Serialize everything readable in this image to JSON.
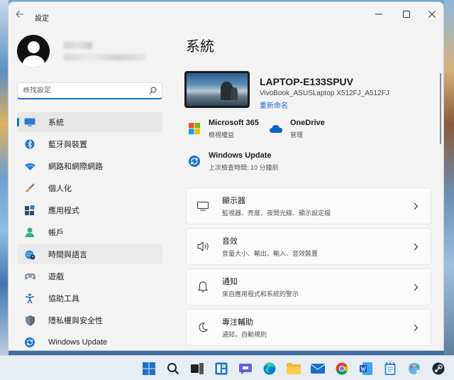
{
  "window": {
    "title": "設定"
  },
  "profile": {
    "avatar_icon": "user-avatar"
  },
  "search": {
    "placeholder": "尋找設定"
  },
  "sidebar": {
    "items": [
      {
        "label": "系統",
        "icon": "monitor-icon",
        "active": true
      },
      {
        "label": "藍牙與裝置",
        "icon": "bluetooth-icon"
      },
      {
        "label": "網路和網際網路",
        "icon": "wifi-icon"
      },
      {
        "label": "個人化",
        "icon": "brush-icon"
      },
      {
        "label": "應用程式",
        "icon": "apps-icon"
      },
      {
        "label": "帳戶",
        "icon": "person-icon"
      },
      {
        "label": "時間與語言",
        "icon": "globe-clock-icon",
        "hover": true
      },
      {
        "label": "遊戲",
        "icon": "gamepad-icon"
      },
      {
        "label": "協助工具",
        "icon": "accessibility-icon"
      },
      {
        "label": "隱私權與安全性",
        "icon": "shield-icon"
      },
      {
        "label": "Windows Update",
        "icon": "update-icon"
      }
    ]
  },
  "main": {
    "title": "系統",
    "device": {
      "name": "LAPTOP-E133SPUV",
      "model": "VivoBook_ASUSLaptop X512FJ_A512FJ",
      "rename": "重新命名"
    },
    "quick": [
      {
        "title": "Microsoft 365",
        "sub": "檢視權益",
        "icon": "microsoft-logo-icon"
      },
      {
        "title": "OneDrive",
        "sub": "管理",
        "icon": "cloud-icon"
      },
      {
        "title": "Windows Update",
        "sub": "上次檢查時間: 10 分鐘前",
        "icon": "update-icon"
      }
    ],
    "cards": [
      {
        "title": "顯示器",
        "desc": "監視器、亮度、夜間光線、顯示設定檔",
        "icon": "display-icon"
      },
      {
        "title": "音效",
        "desc": "音量大小、輸出、輸入、音效裝置",
        "icon": "speaker-icon"
      },
      {
        "title": "通知",
        "desc": "來自應用程式和系統的警示",
        "icon": "bell-icon"
      },
      {
        "title": "專注輔助",
        "desc": "通知，自動規則",
        "icon": "moon-icon"
      }
    ]
  },
  "colors": {
    "accent": "#1a6fc8",
    "window_bg": "#f3f3f3"
  }
}
